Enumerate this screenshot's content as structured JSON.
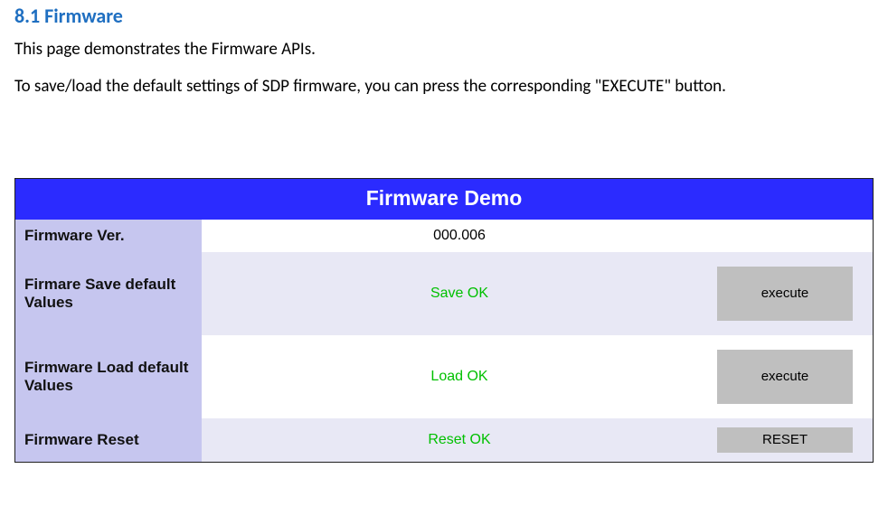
{
  "doc": {
    "heading": "8.1 Firmware",
    "p1": "This page demonstrates the Firmware APIs.",
    "p2": "To save/load the default settings of SDP firmware, you can press the corresponding \"EXECUTE\" button."
  },
  "panel": {
    "title": "Firmware Demo",
    "rows": {
      "ver": {
        "label": "Firmware Ver.",
        "value": "000.006"
      },
      "save": {
        "label": "Firmare Save default Values",
        "value": "Save OK",
        "button": "execute"
      },
      "load": {
        "label": "Firmware Load default Values",
        "value": "Load OK",
        "button": "execute"
      },
      "reset": {
        "label": "Firmware Reset",
        "value": "Reset OK",
        "button": "RESET"
      }
    }
  }
}
